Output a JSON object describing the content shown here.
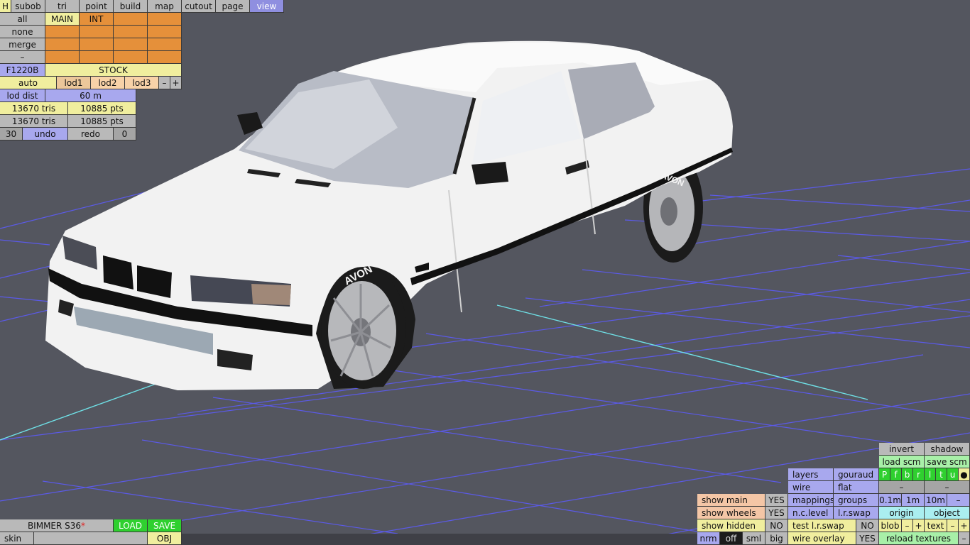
{
  "top_tabs": [
    "H",
    "subob",
    "tri",
    "point",
    "build",
    "map",
    "cutout",
    "page",
    "view"
  ],
  "active_tab": "view",
  "subobject_panel": {
    "select_buttons": [
      "all",
      "none",
      "merge",
      "–"
    ],
    "object_names": [
      "MAIN",
      "INT"
    ],
    "texture": "F1220B",
    "config": "STOCK",
    "lod_buttons": [
      "auto",
      "lod1",
      "lod2",
      "lod3",
      "–",
      "+"
    ],
    "lod_dist_label": "lod dist",
    "lod_dist_value": "60 m",
    "stats": [
      {
        "tris": "13670 tris",
        "pts": "10885 pts"
      },
      {
        "tris": "13670 tris",
        "pts": "10885 pts"
      }
    ],
    "undo_count": "30",
    "undo_label": "undo",
    "redo_label": "redo",
    "redo_count": "0"
  },
  "file_panel": {
    "car_name": "BIMMER S36",
    "modified_mark": "*",
    "load_label": "LOAD",
    "save_label": "SAVE",
    "skin_label": "skin",
    "obj_label": "OBJ"
  },
  "view_panel": {
    "show_main_label": "show main",
    "show_main_value": "YES",
    "show_wheels_label": "show wheels",
    "show_wheels_value": "YES",
    "show_hidden_label": "show hidden",
    "show_hidden_value": "NO",
    "size_buttons": [
      "nrm",
      "off",
      "sml",
      "big"
    ],
    "layers": "layers",
    "gouraud": "gouraud",
    "wire": "wire",
    "flat": "flat",
    "mappings": "mappings",
    "groups": "groups",
    "nc_level": "n.c.level",
    "lr_swap": "l.r.swap",
    "test_lr_swap": "test l.r.swap",
    "test_lr_swap_value": "NO",
    "wire_overlay": "wire overlay",
    "wire_overlay_value": "YES",
    "invert": "invert",
    "shadow": "shadow",
    "load_scm": "load scm",
    "save_scm": "save scm",
    "letters": [
      "P",
      "f",
      "b",
      "r",
      "l",
      "t",
      "u",
      "●"
    ],
    "dash": "–",
    "dist_buttons": [
      "0.1m",
      "1m",
      "10m",
      "–"
    ],
    "origin": "origin",
    "object": "object",
    "blob": "blob",
    "text": "text",
    "minus": "–",
    "plus": "+",
    "reload_textures": "reload textures"
  },
  "tire_brand": "AVON",
  "colors": {
    "background": "#54565f",
    "grid": "#5b5ae8",
    "axis": "#6fe0e6",
    "car_body": "#f2f2f2",
    "active_tab": "#8f8fe0"
  }
}
